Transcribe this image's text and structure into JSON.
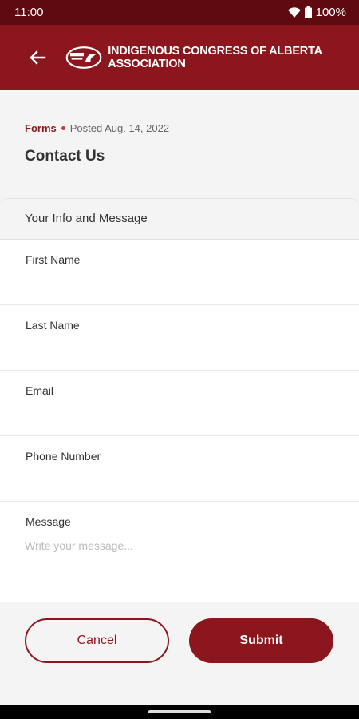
{
  "status": {
    "time": "11:00",
    "battery": "100%"
  },
  "header": {
    "brand": "INDIGENOUS CONGRESS OF ALBERTA ASSOCIATION"
  },
  "post": {
    "category": "Forms",
    "posted": "Posted Aug. 14, 2022",
    "title": "Contact Us"
  },
  "form": {
    "section": "Your Info and Message",
    "fields": [
      {
        "label": "First Name",
        "value": ""
      },
      {
        "label": "Last Name",
        "value": ""
      },
      {
        "label": "Email",
        "value": ""
      },
      {
        "label": "Phone Number",
        "value": ""
      }
    ],
    "message": {
      "label": "Message",
      "placeholder": "Write your message..."
    }
  },
  "actions": {
    "cancel": "Cancel",
    "submit": "Submit"
  },
  "colors": {
    "brand": "#8b161d",
    "status_bar": "#5e0a10"
  }
}
